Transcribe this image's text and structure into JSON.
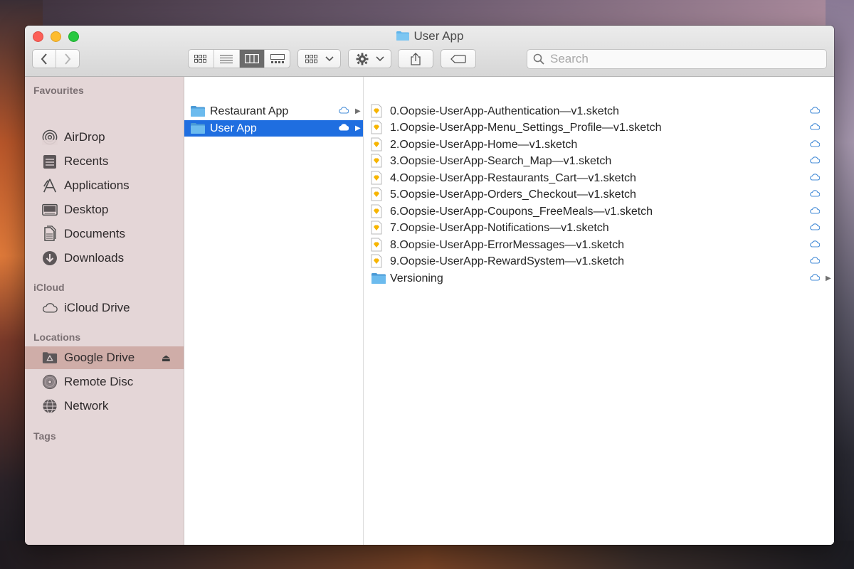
{
  "window": {
    "title": "User App"
  },
  "toolbar": {
    "back_icon": "chevron-left-icon",
    "forward_icon": "chevron-right-icon",
    "views": [
      "icon-view",
      "list-view",
      "column-view",
      "gallery-view"
    ],
    "active_view": "column-view",
    "search_placeholder": "Search"
  },
  "sidebar": {
    "favourites_heading": "Favourites",
    "favourites": [
      {
        "label": "AirDrop",
        "icon": "airdrop-icon"
      },
      {
        "label": "Recents",
        "icon": "recents-icon"
      },
      {
        "label": "Applications",
        "icon": "applications-icon"
      },
      {
        "label": "Desktop",
        "icon": "desktop-icon"
      },
      {
        "label": "Documents",
        "icon": "documents-icon"
      },
      {
        "label": "Downloads",
        "icon": "downloads-icon"
      }
    ],
    "icloud_heading": "iCloud",
    "icloud": [
      {
        "label": "iCloud Drive",
        "icon": "cloud-icon"
      }
    ],
    "locations_heading": "Locations",
    "locations": [
      {
        "label": "Google Drive",
        "icon": "google-drive-icon",
        "selected": true
      },
      {
        "label": "Remote Disc",
        "icon": "disc-icon"
      },
      {
        "label": "Network",
        "icon": "network-icon"
      }
    ],
    "tags_heading": "Tags"
  },
  "column1": {
    "items": [
      {
        "label": "Restaurant App",
        "selected": false
      },
      {
        "label": "User App",
        "selected": true
      }
    ]
  },
  "column2": {
    "items": [
      {
        "label": "0.Oopsie-UserApp-Authentication—v1.sketch",
        "type": "sketch"
      },
      {
        "label": "1.Oopsie-UserApp-Menu_Settings_Profile—v1.sketch",
        "type": "sketch"
      },
      {
        "label": "2.Oopsie-UserApp-Home—v1.sketch",
        "type": "sketch"
      },
      {
        "label": "3.Oopsie-UserApp-Search_Map—v1.sketch",
        "type": "sketch"
      },
      {
        "label": "4.Oopsie-UserApp-Restaurants_Cart—v1.sketch",
        "type": "sketch"
      },
      {
        "label": "5.Oopsie-UserApp-Orders_Checkout—v1.sketch",
        "type": "sketch"
      },
      {
        "label": "6.Oopsie-UserApp-Coupons_FreeMeals—v1.sketch",
        "type": "sketch"
      },
      {
        "label": "7.Oopsie-UserApp-Notifications—v1.sketch",
        "type": "sketch"
      },
      {
        "label": "8.Oopsie-UserApp-ErrorMessages—v1.sketch",
        "type": "sketch"
      },
      {
        "label": "9.Oopsie-UserApp-RewardSystem—v1.sketch",
        "type": "sketch"
      },
      {
        "label": "Versioning",
        "type": "folder"
      }
    ]
  },
  "colors": {
    "selection": "#1f6ee0",
    "folder": "#5fb4ea",
    "cloud": "#4a8fd8"
  }
}
